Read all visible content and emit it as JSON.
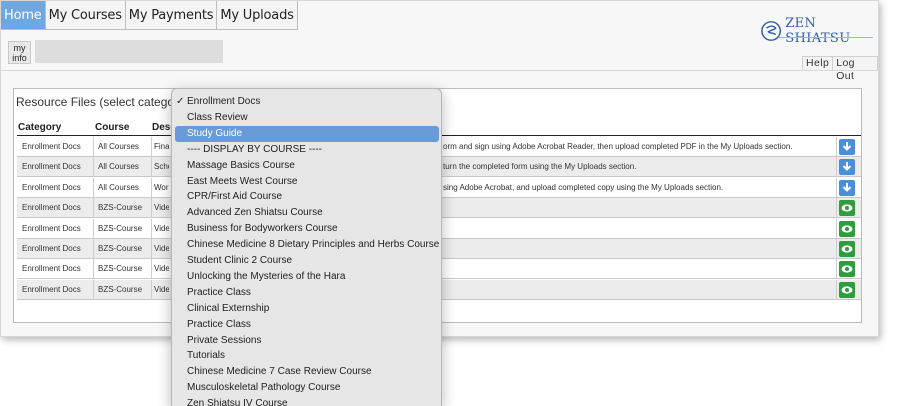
{
  "nav": {
    "tabs": [
      {
        "label": "Home",
        "active": true
      },
      {
        "label": "My Courses",
        "active": false
      },
      {
        "label": "My Payments",
        "active": false
      },
      {
        "label": "My Uploads",
        "active": false
      }
    ]
  },
  "brand": {
    "name": "ZEN SHIATSU",
    "icon": "zen-logo-icon",
    "color": "#2e5ea8"
  },
  "user": {
    "my_info_label": "my info"
  },
  "util_links": [
    "Help",
    "Log Out"
  ],
  "resource_files": {
    "title": "Resource Files (select category)",
    "columns": [
      "Category",
      "Course",
      "Desc"
    ],
    "rows": [
      {
        "category": "Enrollment Docs",
        "course": "All Courses",
        "desc": "Finar",
        "desc_tail": "orm and sign using Adobe Acrobat Reader, then upload completed PDF in the My Uploads section.",
        "action_icon": "download-icon"
      },
      {
        "category": "Enrollment Docs",
        "course": "All Courses",
        "desc": "Scho",
        "desc_tail": "turn the completed form using the My Uploads section.",
        "action_icon": "download-icon"
      },
      {
        "category": "Enrollment Docs",
        "course": "All Courses",
        "desc": "Work",
        "desc_tail": "sing Adobe Acrobat, and upload completed copy using the My Uploads section.",
        "action_icon": "download-icon"
      },
      {
        "category": "Enrollment Docs",
        "course": "BZS-Course",
        "desc": "Vide",
        "desc_tail": "",
        "action_icon": "eye-icon"
      },
      {
        "category": "Enrollment Docs",
        "course": "BZS-Course",
        "desc": "Vide",
        "desc_tail": "",
        "action_icon": "eye-icon"
      },
      {
        "category": "Enrollment Docs",
        "course": "BZS-Course",
        "desc": "Vide",
        "desc_tail": "",
        "action_icon": "eye-icon"
      },
      {
        "category": "Enrollment Docs",
        "course": "BZS-Course",
        "desc": "Vide",
        "desc_tail": "",
        "action_icon": "eye-icon"
      },
      {
        "category": "Enrollment Docs",
        "course": "BZS-Course",
        "desc": "Vide",
        "desc_tail": "",
        "action_icon": "eye-icon"
      }
    ]
  },
  "category_dropdown": {
    "check_mark": "✓",
    "selected_value": "Enrollment Docs",
    "highlighted": "Study Guide",
    "options": [
      "Enrollment Docs",
      "Class Review",
      "Study Guide",
      "---- DISPLAY BY COURSE ----",
      "Massage Basics Course",
      "East Meets West Course",
      "CPR/First Aid Course",
      "Advanced Zen Shiatsu Course",
      "Business for Bodyworkers Course",
      "Chinese Medicine 8 Dietary Principles and Herbs Course",
      "Student Clinic 2 Course",
      "Unlocking the Mysteries of the Hara",
      "Practice Class",
      "Clinical Externship",
      "Practice Class",
      "Private Sessions",
      "Tutorials",
      "Chinese Medicine 7 Case Review Course",
      "Musculoskeletal Pathology Course",
      "Zen Shiatsu IV Course"
    ]
  },
  "colors": {
    "nav_active": "#6fa7e0",
    "dropdown_highlight": "#6a9ad8",
    "download_icon": "#4a8fd9",
    "view_icon": "#2f9c3d"
  }
}
